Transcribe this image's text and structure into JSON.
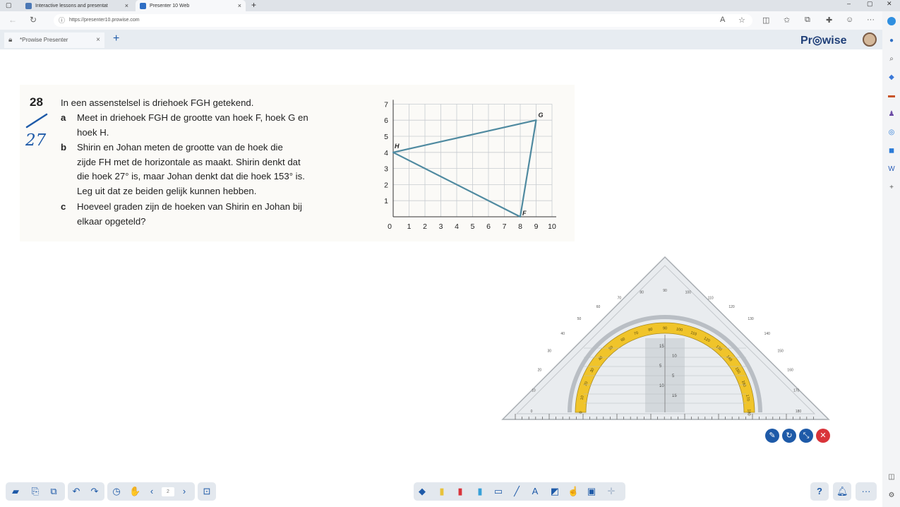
{
  "browser": {
    "tabs": [
      {
        "title": "Interactive lessons and presentat",
        "close": "×"
      },
      {
        "title": "Presenter 10 Web",
        "close": "×"
      }
    ],
    "new_tab": "+",
    "window_controls": [
      "–",
      "▢",
      "✕"
    ],
    "url": "https://presenter10.prowise.com",
    "more_menu": "···"
  },
  "app": {
    "tab_title": "*Prowise Presenter",
    "tab_close": "×",
    "add_tab": "+",
    "logo": "Pr◎wise"
  },
  "exercise": {
    "number": "28",
    "intro": "In een assenstelsel is driehoek FGH getekend.",
    "parts": [
      {
        "label": "a",
        "lines": [
          "Meet in driehoek FGH de grootte van hoek F, hoek G en",
          "hoek H."
        ]
      },
      {
        "label": "b",
        "lines": [
          "Shirin en Johan meten de grootte van de hoek die",
          "zijde FH met de horizontale as maakt. Shirin denkt dat",
          "die hoek 27° is, maar Johan denkt dat die hoek 153° is.",
          "Leg uit dat ze beiden gelijk kunnen hebben."
        ]
      },
      {
        "label": "c",
        "lines": [
          "Hoeveel graden zijn de hoeken van Shirin en Johan bij",
          "elkaar opgeteld?"
        ]
      }
    ],
    "annotation": "27"
  },
  "chart_data": {
    "type": "scatter",
    "x_ticks": [
      "0",
      "1",
      "2",
      "3",
      "4",
      "5",
      "6",
      "7",
      "8",
      "9",
      "10"
    ],
    "y_ticks": [
      "1",
      "2",
      "3",
      "4",
      "5",
      "6",
      "7"
    ],
    "xlim": [
      0,
      10
    ],
    "ylim": [
      0,
      7
    ],
    "grid": true,
    "points": [
      {
        "label": "H",
        "x": 0,
        "y": 4
      },
      {
        "label": "G",
        "x": 9,
        "y": 6
      },
      {
        "label": "F",
        "x": 8,
        "y": 0
      }
    ],
    "polygon": [
      "H",
      "G",
      "F"
    ],
    "line_color": "#4f8aa0"
  },
  "protractor": {
    "inner_scale": [
      "0",
      "10",
      "20",
      "30",
      "40",
      "50",
      "60",
      "70",
      "80",
      "90",
      "100",
      "110",
      "120",
      "130",
      "140",
      "150",
      "160",
      "170",
      "180"
    ],
    "center_scale": [
      "15",
      "10",
      "5",
      "5",
      "10",
      "15"
    ]
  },
  "toolbar": {
    "page_number": "2"
  },
  "colors": {
    "accent": "#1e5aa8",
    "close_red": "#d9343a",
    "protractor_band": "#f0c42a"
  }
}
